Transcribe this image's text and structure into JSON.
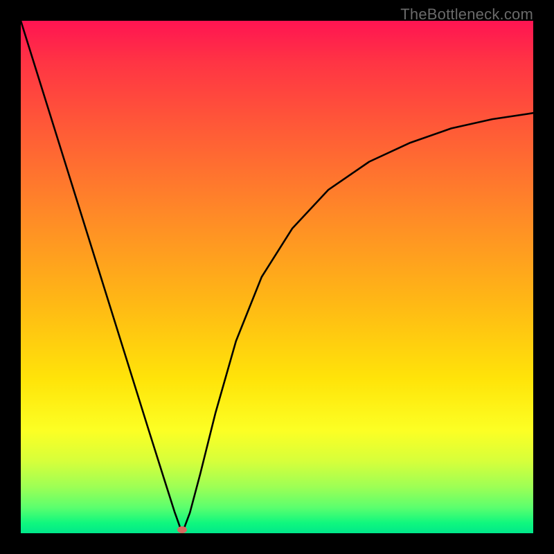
{
  "watermark": "TheBottleneck.com",
  "marker": {
    "x_frac": 0.315,
    "y_frac": 1.0
  },
  "chart_data": {
    "type": "line",
    "title": "",
    "xlabel": "",
    "ylabel": "",
    "xlim": [
      0,
      1
    ],
    "ylim": [
      0,
      1
    ],
    "description": "V-shaped bottleneck curve: steep linear descent from top-left to a minimum near x≈0.315 at y≈0, then a convex rise that asymptotically flattens toward y≈0.82 at the right edge.",
    "series": [
      {
        "name": "bottleneck-curve",
        "x": [
          0.0,
          0.05,
          0.1,
          0.15,
          0.2,
          0.25,
          0.28,
          0.3,
          0.315,
          0.33,
          0.35,
          0.38,
          0.42,
          0.47,
          0.53,
          0.6,
          0.68,
          0.76,
          0.84,
          0.92,
          1.0
        ],
        "y": [
          1.0,
          0.84,
          0.68,
          0.52,
          0.36,
          0.2,
          0.105,
          0.042,
          0.0,
          0.04,
          0.115,
          0.235,
          0.375,
          0.5,
          0.595,
          0.67,
          0.725,
          0.762,
          0.79,
          0.808,
          0.82
        ]
      }
    ],
    "marker_point": {
      "x": 0.315,
      "y": 0.0
    },
    "grid": false,
    "legend": false
  }
}
